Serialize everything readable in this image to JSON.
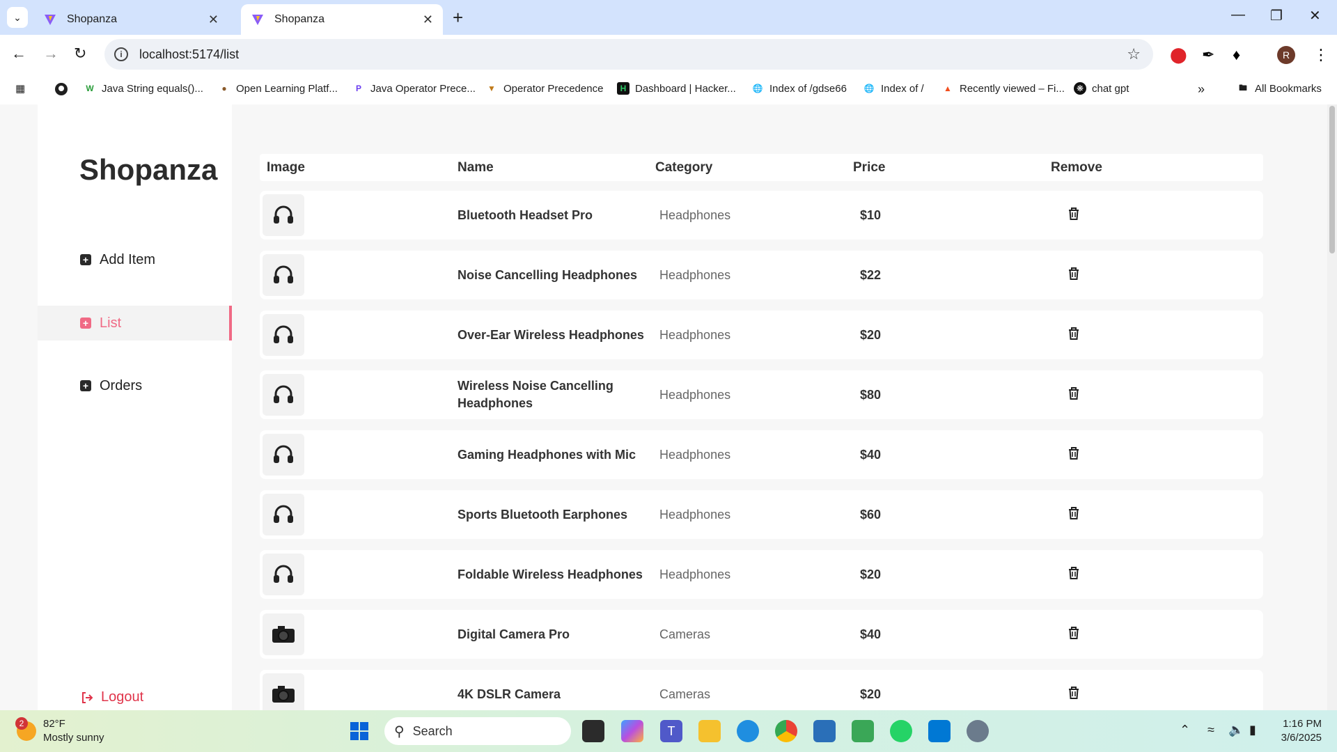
{
  "browser": {
    "tabs": [
      {
        "title": "Shopanza",
        "active": false
      },
      {
        "title": "Shopanza",
        "active": true
      }
    ],
    "url": "localhost:5174/list",
    "profile_initial": "R",
    "bookmarks": [
      {
        "label": "Java String equals()...",
        "icon": "w-icon"
      },
      {
        "label": "Open Learning Platf...",
        "icon": "owl-icon"
      },
      {
        "label": "Java Operator Prece...",
        "icon": "p-icon"
      },
      {
        "label": "Operator Precedence",
        "icon": "shield-icon"
      },
      {
        "label": "Dashboard | Hacker...",
        "icon": "hackerrank-icon"
      },
      {
        "label": "Index of /gdse66",
        "icon": "globe-icon"
      },
      {
        "label": "Index of /",
        "icon": "globe-icon"
      },
      {
        "label": "Recently viewed – Fi...",
        "icon": "figma-icon"
      },
      {
        "label": "chat gpt",
        "icon": "openai-icon"
      }
    ],
    "all_bookmarks_label": "All Bookmarks"
  },
  "sidebar": {
    "brand": "Shopanza",
    "items": [
      {
        "label": "Add Item",
        "active": false
      },
      {
        "label": "List",
        "active": true
      },
      {
        "label": "Orders",
        "active": false
      }
    ],
    "logout_label": "Logout"
  },
  "table": {
    "headers": [
      "Image",
      "Name",
      "Category",
      "Price",
      "Remove"
    ],
    "rows": [
      {
        "name": "Bluetooth Headset Pro",
        "category": "Headphones",
        "price": "$10",
        "image": "headphones-icon"
      },
      {
        "name": "Noise Cancelling Headphones",
        "category": "Headphones",
        "price": "$22",
        "image": "headphones-icon"
      },
      {
        "name": "Over-Ear Wireless Headphones",
        "category": "Headphones",
        "price": "$20",
        "image": "headphones-icon"
      },
      {
        "name": "Wireless Noise Cancelling Headphones",
        "category": "Headphones",
        "price": "$80",
        "image": "headphones-icon"
      },
      {
        "name": "Gaming Headphones with Mic",
        "category": "Headphones",
        "price": "$40",
        "image": "headphones-icon"
      },
      {
        "name": "Sports Bluetooth Earphones",
        "category": "Headphones",
        "price": "$60",
        "image": "headphones-icon"
      },
      {
        "name": "Foldable Wireless Headphones",
        "category": "Headphones",
        "price": "$20",
        "image": "headphones-icon"
      },
      {
        "name": "Digital Camera Pro",
        "category": "Cameras",
        "price": "$40",
        "image": "camera-icon"
      },
      {
        "name": "4K DSLR Camera",
        "category": "Cameras",
        "price": "$20",
        "image": "camera-icon"
      }
    ]
  },
  "taskbar": {
    "weather_temp": "82°F",
    "weather_desc": "Mostly sunny",
    "weather_badge": "2",
    "search_placeholder": "Search",
    "time": "1:16 PM",
    "date": "3/6/2025"
  },
  "colors": {
    "accent": "#f06a85",
    "logout": "#e0344a",
    "tabbar": "#d3e3fd"
  }
}
